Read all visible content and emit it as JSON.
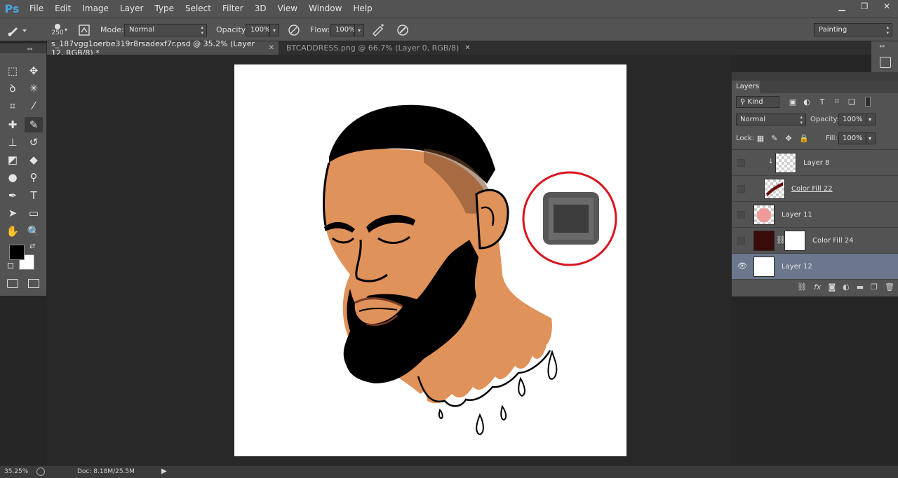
{
  "app": {
    "logo": "Ps"
  },
  "menu": [
    "File",
    "Edit",
    "Image",
    "Layer",
    "Type",
    "Select",
    "Filter",
    "3D",
    "View",
    "Window",
    "Help"
  ],
  "window_controls": {
    "minimize": "▁",
    "restore": "❐",
    "close": "✕"
  },
  "options_bar": {
    "brush_size": "250",
    "mode_label": "Mode:",
    "mode_value": "Normal",
    "opacity_label": "Opacity:",
    "opacity_value": "100%",
    "flow_label": "Flow:",
    "flow_value": "100%",
    "workspace": "Painting"
  },
  "tabs": [
    {
      "label": "s_187vgg1oerbe319r8rsadexf7r.psd @ 35.2% (Layer 12, RGB/8) *",
      "active": true
    },
    {
      "label": "BTCADDRESS.png @ 66.7% (Layer 0, RGB/8)",
      "active": false
    }
  ],
  "tab_close_glyph": "✕",
  "toolbox": {
    "collapse": "◂◂",
    "tools": [
      {
        "name": "marquee-tool",
        "glyph": "⬚"
      },
      {
        "name": "move-tool",
        "glyph": "✥"
      },
      {
        "name": "lasso-tool",
        "glyph": "ꝺ"
      },
      {
        "name": "magic-wand-tool",
        "glyph": "✳"
      },
      {
        "name": "crop-tool",
        "glyph": "⌗"
      },
      {
        "name": "eyedropper-tool",
        "glyph": "⁄"
      },
      {
        "name": "healing-tool",
        "glyph": "✚"
      },
      {
        "name": "brush-tool",
        "glyph": "✎"
      },
      {
        "name": "stamp-tool",
        "glyph": "⊥"
      },
      {
        "name": "history-brush-tool",
        "glyph": "↺"
      },
      {
        "name": "eraser-tool",
        "glyph": "◩"
      },
      {
        "name": "paint-bucket-tool",
        "glyph": "◆"
      },
      {
        "name": "blur-tool",
        "glyph": "●"
      },
      {
        "name": "dodge-tool",
        "glyph": "⚲"
      },
      {
        "name": "pen-tool",
        "glyph": "✒"
      },
      {
        "name": "type-tool",
        "glyph": "T"
      },
      {
        "name": "path-select-tool",
        "glyph": "➤"
      },
      {
        "name": "shape-tool",
        "glyph": "▭"
      },
      {
        "name": "hand-tool",
        "glyph": "✋"
      },
      {
        "name": "zoom-tool",
        "glyph": "🔍"
      }
    ],
    "foreground_color": "#000000",
    "background_color": "#ffffff"
  },
  "layers_panel": {
    "title": "Layers",
    "filter_kind": "Kind",
    "blend_mode": "Normal",
    "opacity_label": "Opacity:",
    "opacity_value": "100%",
    "lock_label": "Lock:",
    "fill_label": "Fill:",
    "fill_value": "100%",
    "layers": [
      {
        "name": "Layer 8",
        "visible": false,
        "selected": false
      },
      {
        "name": "Color Fill 22",
        "visible": false,
        "selected": false
      },
      {
        "name": "Layer 11",
        "visible": false,
        "selected": false
      },
      {
        "name": "Color Fill 24",
        "visible": false,
        "selected": false
      },
      {
        "name": "Layer 12",
        "visible": true,
        "selected": true
      }
    ],
    "footer_icons": [
      "link-icon",
      "fx-icon",
      "mask-icon",
      "adjustment-icon",
      "folder-icon",
      "new-layer-icon",
      "trash-icon"
    ],
    "footer_fx": "fx"
  },
  "status": {
    "zoom": "35.25%",
    "doc": "Doc: 8.18M/25.5M"
  },
  "colors": {
    "skin": "#E0925B",
    "hair": "#000000",
    "highlight_ring": "#D9141E",
    "selected_layer": "#6B778C",
    "color_fill_24": "#3A0B0B"
  }
}
